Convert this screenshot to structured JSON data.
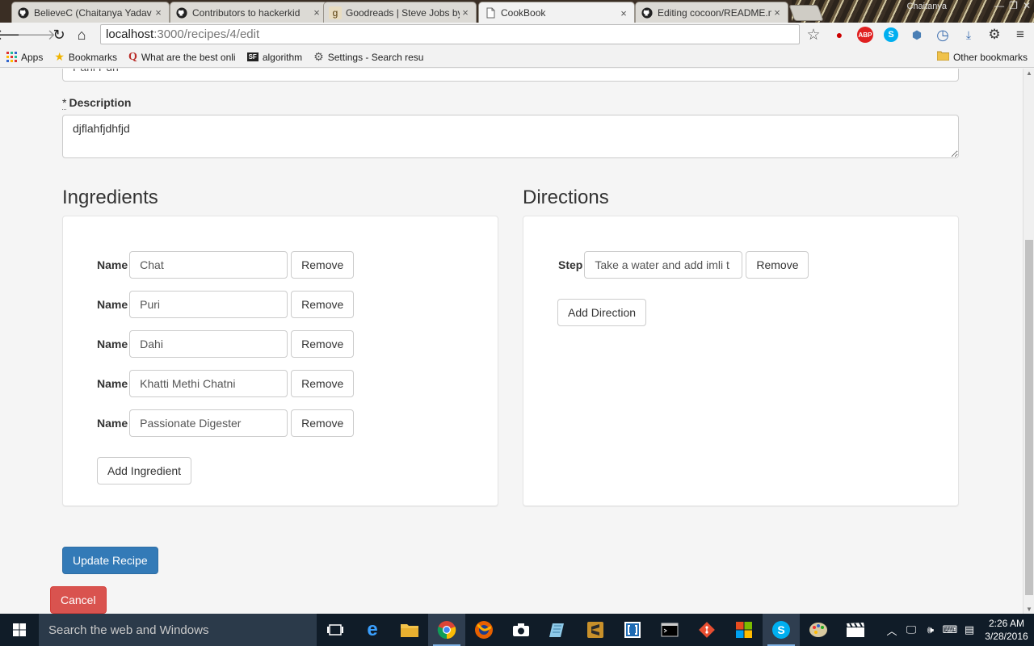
{
  "browser": {
    "tabs": [
      {
        "title": "BelieveC (Chaitanya Yadav",
        "icon": "github-icon",
        "active": false
      },
      {
        "title": "Contributors to hackerkid",
        "icon": "github-icon",
        "active": false
      },
      {
        "title": "Goodreads | Steve Jobs by",
        "icon": "goodreads-icon",
        "active": false
      },
      {
        "title": "CookBook",
        "icon": "page-icon",
        "active": true
      },
      {
        "title": "Editing cocoon/README.m",
        "icon": "github-icon",
        "active": false
      }
    ],
    "username": "Chaitanya",
    "url_host": "localhost",
    "url_path": ":3000/recipes/4/edit",
    "bookmarks": [
      {
        "label": "Apps",
        "icon": "apps-grid-icon"
      },
      {
        "label": "Bookmarks",
        "icon": "star-icon"
      },
      {
        "label": "What are the best onli",
        "icon": "quora-icon"
      },
      {
        "label": "algorithm",
        "icon": "sf-icon"
      },
      {
        "label": "Settings - Search resu",
        "icon": "gear-icon"
      }
    ],
    "other_bookmarks": "Other bookmarks"
  },
  "form": {
    "name_value": "Pani Puri",
    "description_required": "*",
    "description_label": "Description",
    "description_value": "djflahfjdhfjd",
    "ingredients_title": "Ingredients",
    "directions_title": "Directions",
    "ingredient_label": "Name",
    "step_label": "Step",
    "remove_label": "Remove",
    "ingredients": [
      {
        "name": "Chat"
      },
      {
        "name": "Puri"
      },
      {
        "name": "Dahi"
      },
      {
        "name": "Khatti Methi Chatni"
      },
      {
        "name": "Passionate Digester"
      }
    ],
    "directions": [
      {
        "step": "Take a water and add imli t"
      }
    ],
    "add_ingredient_label": "Add Ingredient",
    "add_direction_label": "Add Direction",
    "submit_label": "Update Recipe",
    "cancel_label": "Cancel"
  },
  "taskbar": {
    "search_placeholder": "Search the web and Windows",
    "time": "2:26 AM",
    "date": "3/28/2016",
    "colors": {
      "bar": "#101c28",
      "primary": "#337ab7",
      "danger": "#d9534f"
    }
  }
}
